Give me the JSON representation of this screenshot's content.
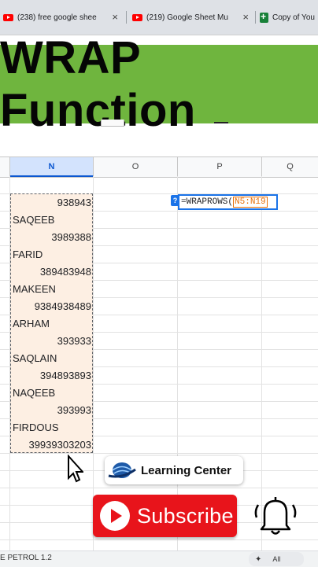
{
  "browser": {
    "tabs": [
      {
        "icon": "youtube-icon",
        "title": "(238) free google shee"
      },
      {
        "icon": "youtube-icon",
        "title": "(219) Google Sheet Mu"
      },
      {
        "icon": "sheets-icon",
        "title": "Copy of You"
      }
    ],
    "close_glyph": "×"
  },
  "banner": {
    "title": "WRAP Function",
    "color": "#6fb53e"
  },
  "sheet": {
    "columns": [
      "N",
      "O",
      "P",
      "Q"
    ],
    "selected_column": "N",
    "cells": [
      {
        "value": "938943",
        "align": "num"
      },
      {
        "value": "SAQEEB",
        "align": "txt"
      },
      {
        "value": "3989388",
        "align": "num"
      },
      {
        "value": "FARID",
        "align": "txt"
      },
      {
        "value": "389483948",
        "align": "num"
      },
      {
        "value": "MAKEEN",
        "align": "txt"
      },
      {
        "value": "9384938489",
        "align": "num"
      },
      {
        "value": "ARHAM",
        "align": "txt"
      },
      {
        "value": "393933",
        "align": "num"
      },
      {
        "value": "SAQLAIN",
        "align": "txt"
      },
      {
        "value": "394893893",
        "align": "num"
      },
      {
        "value": "NAQEEB",
        "align": "txt"
      },
      {
        "value": "393993",
        "align": "num"
      },
      {
        "value": "FIRDOUS",
        "align": "txt"
      },
      {
        "value": "39939303203",
        "align": "num"
      }
    ],
    "formula": {
      "prefix": "=WRAPROWS(",
      "range": "N5:N19"
    },
    "help_badge": "?",
    "sheet_tab_label": "E PETROL 1.2",
    "filter_label": "All"
  },
  "overlay": {
    "brand_label": "Learning Center",
    "subscribe_label": "Subscribe",
    "subscribe_color": "#e8141b"
  }
}
